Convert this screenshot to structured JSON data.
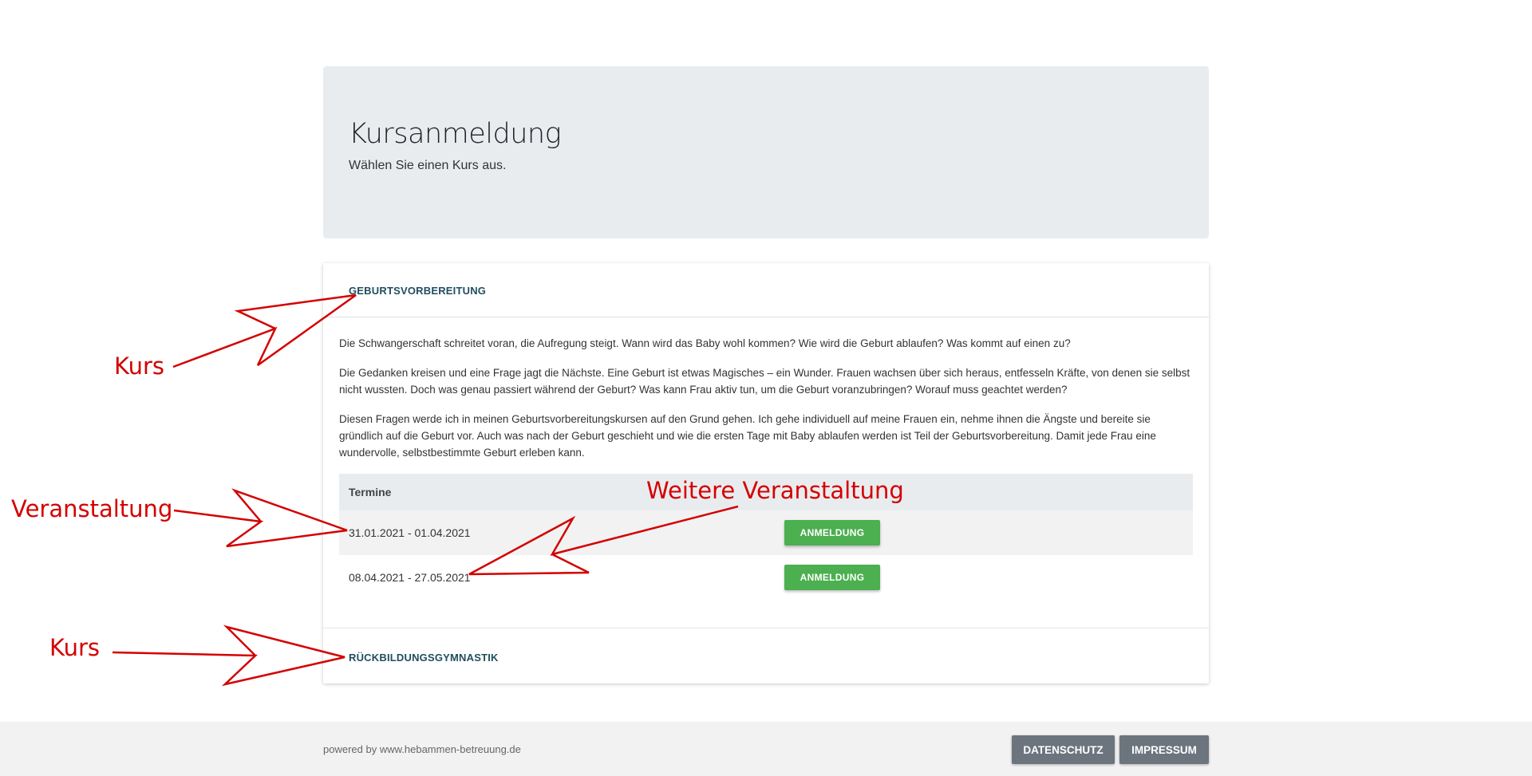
{
  "hero": {
    "title": "Kursanmeldung",
    "subtitle": "Wählen Sie einen Kurs aus."
  },
  "courses": [
    {
      "title": "GEBURTSVORBEREITUNG",
      "paragraphs": [
        "Die Schwangerschaft schreitet voran, die Aufregung steigt. Wann wird das Baby wohl kommen? Wie wird die Geburt ablaufen? Was kommt auf einen zu?",
        "Die Gedanken kreisen und eine Frage jagt die Nächste. Eine Geburt ist etwas Magisches – ein Wunder. Frauen wachsen über sich heraus, entfesseln Kräfte, von denen sie selbst nicht wussten. Doch was genau passiert während der Geburt? Was kann Frau aktiv tun, um die Geburt voranzubringen? Worauf muss geachtet werden?",
        "Diesen Fragen werde ich in meinen Geburtsvorbereitungskursen auf den Grund gehen. Ich gehe individuell auf meine Frauen ein, nehme ihnen die Ängste und bereite sie gründlich auf die Geburt vor. Auch was nach der Geburt geschieht und wie die ersten Tage mit Baby ablaufen werden ist Teil der Geburtsvorbereitung. Damit jede Frau eine wundervolle, selbstbestimmte Geburt erleben kann."
      ],
      "table_header": "Termine",
      "dates": [
        {
          "range": "31.01.2021 - 01.04.2021",
          "button": "ANMELDUNG"
        },
        {
          "range": "08.04.2021 - 27.05.2021",
          "button": "ANMELDUNG"
        }
      ]
    },
    {
      "title": "RÜCKBILDUNGSGYMNASTIK"
    }
  ],
  "footer": {
    "powered": "powered by www.hebammen-betreuung.de",
    "privacy": "DATENSCHUTZ",
    "imprint": "IMPRESSUM"
  },
  "annotations": {
    "kurs_1": "Kurs",
    "veranstaltung": "Veranstaltung",
    "weitere": "Weitere Veranstaltung",
    "kurs_2": "Kurs",
    "color": "#d40000"
  },
  "colors": {
    "hero_bg": "#e9ecef",
    "course_title": "#1f4e5f",
    "button_green": "#4caf50",
    "footer_button": "#6c757d"
  }
}
